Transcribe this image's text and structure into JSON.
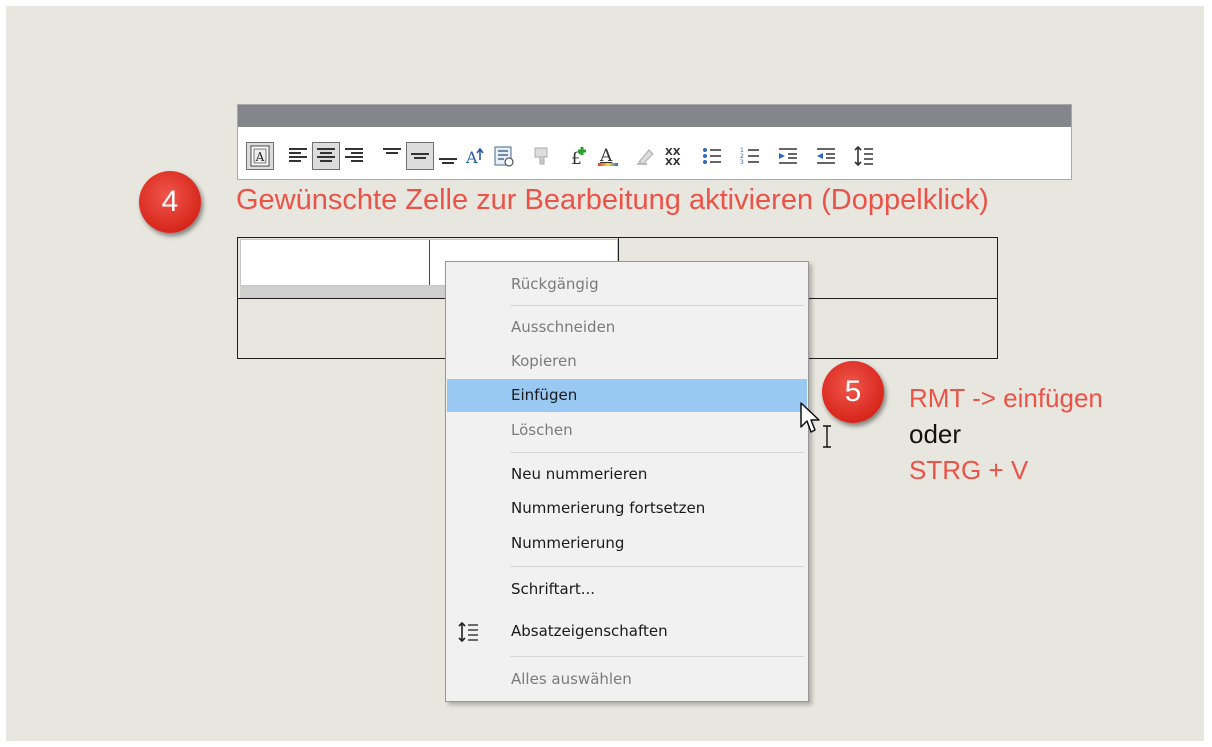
{
  "toolbar": {
    "buttons": [
      "text-frame-icon",
      "align-left-icon",
      "align-center-icon",
      "align-right-icon",
      "valign-top-icon",
      "valign-middle-icon",
      "valign-bottom-icon",
      "text-autofit-icon",
      "text-properties-icon",
      "clear-format-icon",
      "insert-field-icon",
      "font-color-icon",
      "highlight-icon",
      "strikethrough-icon",
      "bullet-list-icon",
      "numbered-list-icon",
      "increase-indent-icon",
      "decrease-indent-icon",
      "line-spacing-icon"
    ]
  },
  "annotation4": {
    "badge": "4",
    "text": "Gewünschte Zelle zur Bearbeitung aktivieren (Doppelklick)"
  },
  "annotation5": {
    "badge": "5",
    "line1": "RMT -> einfügen",
    "line2": "oder",
    "line3": "STRG + V"
  },
  "context_menu": {
    "items": [
      {
        "label": "Rückgängig",
        "enabled": false
      },
      {
        "label": "Ausschneiden",
        "enabled": false
      },
      {
        "label": "Kopieren",
        "enabled": false
      },
      {
        "label": "Einfügen",
        "enabled": true,
        "highlighted": true
      },
      {
        "label": "Löschen",
        "enabled": false
      },
      {
        "label": "Neu nummerieren",
        "enabled": true
      },
      {
        "label": "Nummerierung fortsetzen",
        "enabled": true
      },
      {
        "label": "Nummerierung",
        "enabled": true
      },
      {
        "label": "Schriftart...",
        "enabled": true
      },
      {
        "label": "Absatzeigenschaften",
        "enabled": true,
        "icon": "line-spacing-icon"
      },
      {
        "label": "Alles auswählen",
        "enabled": false
      }
    ]
  },
  "colors": {
    "annotation_red": "#ec5348",
    "menu_highlight": "#99c9f2",
    "background": "#e8e7df"
  }
}
